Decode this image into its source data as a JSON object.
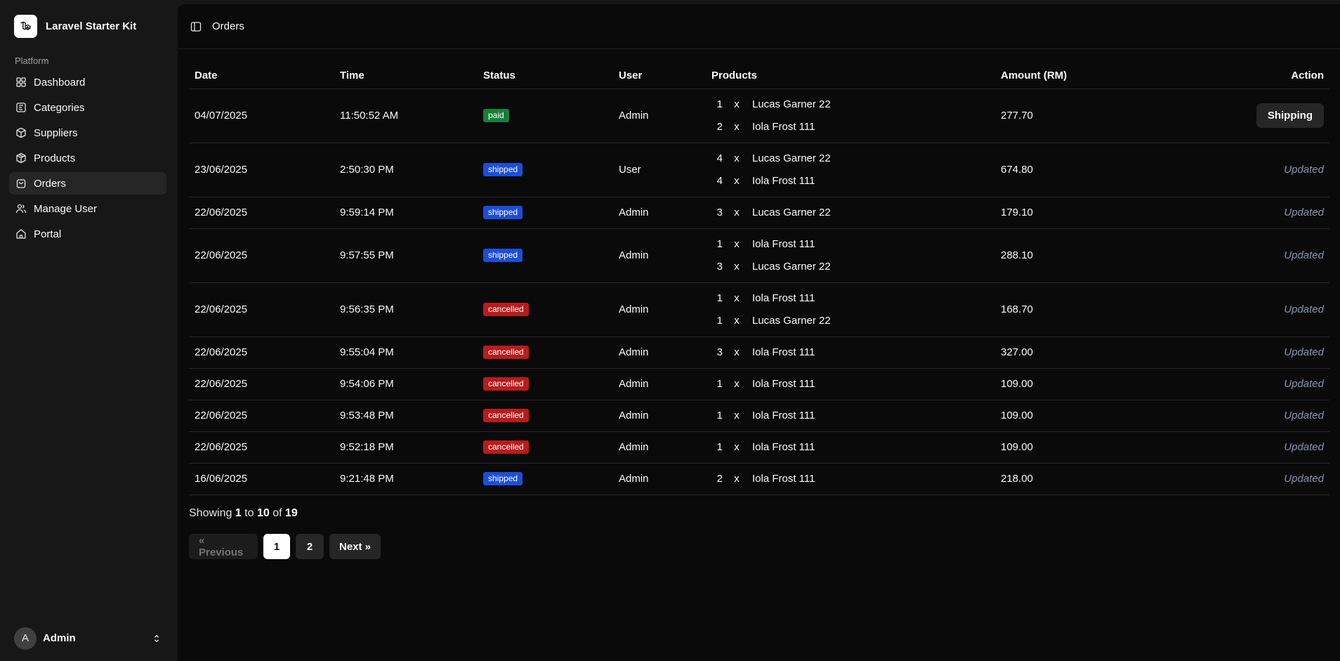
{
  "sidebar": {
    "brand": "Laravel Starter Kit",
    "group_label": "Platform",
    "items": [
      {
        "label": "Dashboard",
        "icon": "dashboard-icon",
        "active": false
      },
      {
        "label": "Categories",
        "icon": "categories-icon",
        "active": false
      },
      {
        "label": "Suppliers",
        "icon": "suppliers-icon",
        "active": false
      },
      {
        "label": "Products",
        "icon": "products-icon",
        "active": false
      },
      {
        "label": "Orders",
        "icon": "orders-icon",
        "active": true
      },
      {
        "label": "Manage User",
        "icon": "users-icon",
        "active": false
      },
      {
        "label": "Portal",
        "icon": "home-icon",
        "active": false
      }
    ],
    "user": {
      "initial": "A",
      "name": "Admin"
    }
  },
  "header": {
    "title": "Orders"
  },
  "table": {
    "columns": [
      "Date",
      "Time",
      "Status",
      "User",
      "Products",
      "Amount (RM)",
      "Action"
    ],
    "rows": [
      {
        "date": "04/07/2025",
        "time": "11:50:52 AM",
        "status": "paid",
        "user": "Admin",
        "products": [
          {
            "qty": "1",
            "x": "x",
            "name": "Lucas Garner 22"
          },
          {
            "qty": "2",
            "x": "x",
            "name": "Iola Frost 111"
          }
        ],
        "amount": "277.70",
        "action": "Shipping"
      },
      {
        "date": "23/06/2025",
        "time": "2:50:30 PM",
        "status": "shipped",
        "user": "User",
        "products": [
          {
            "qty": "4",
            "x": "x",
            "name": "Lucas Garner 22"
          },
          {
            "qty": "4",
            "x": "x",
            "name": "Iola Frost 111"
          }
        ],
        "amount": "674.80",
        "action": "Updated"
      },
      {
        "date": "22/06/2025",
        "time": "9:59:14 PM",
        "status": "shipped",
        "user": "Admin",
        "products": [
          {
            "qty": "3",
            "x": "x",
            "name": "Lucas Garner 22"
          }
        ],
        "amount": "179.10",
        "action": "Updated"
      },
      {
        "date": "22/06/2025",
        "time": "9:57:55 PM",
        "status": "shipped",
        "user": "Admin",
        "products": [
          {
            "qty": "1",
            "x": "x",
            "name": "Iola Frost 111"
          },
          {
            "qty": "3",
            "x": "x",
            "name": "Lucas Garner 22"
          }
        ],
        "amount": "288.10",
        "action": "Updated"
      },
      {
        "date": "22/06/2025",
        "time": "9:56:35 PM",
        "status": "cancelled",
        "user": "Admin",
        "products": [
          {
            "qty": "1",
            "x": "x",
            "name": "Iola Frost 111"
          },
          {
            "qty": "1",
            "x": "x",
            "name": "Lucas Garner 22"
          }
        ],
        "amount": "168.70",
        "action": "Updated"
      },
      {
        "date": "22/06/2025",
        "time": "9:55:04 PM",
        "status": "cancelled",
        "user": "Admin",
        "products": [
          {
            "qty": "3",
            "x": "x",
            "name": "Iola Frost 111"
          }
        ],
        "amount": "327.00",
        "action": "Updated"
      },
      {
        "date": "22/06/2025",
        "time": "9:54:06 PM",
        "status": "cancelled",
        "user": "Admin",
        "products": [
          {
            "qty": "1",
            "x": "x",
            "name": "Iola Frost 111"
          }
        ],
        "amount": "109.00",
        "action": "Updated"
      },
      {
        "date": "22/06/2025",
        "time": "9:53:48 PM",
        "status": "cancelled",
        "user": "Admin",
        "products": [
          {
            "qty": "1",
            "x": "x",
            "name": "Iola Frost 111"
          }
        ],
        "amount": "109.00",
        "action": "Updated"
      },
      {
        "date": "22/06/2025",
        "time": "9:52:18 PM",
        "status": "cancelled",
        "user": "Admin",
        "products": [
          {
            "qty": "1",
            "x": "x",
            "name": "Iola Frost 111"
          }
        ],
        "amount": "109.00",
        "action": "Updated"
      },
      {
        "date": "16/06/2025",
        "time": "9:21:48 PM",
        "status": "shipped",
        "user": "Admin",
        "products": [
          {
            "qty": "2",
            "x": "x",
            "name": "Iola Frost 111"
          }
        ],
        "amount": "218.00",
        "action": "Updated"
      }
    ]
  },
  "pagination": {
    "showing_prefix": "Showing",
    "from": "1",
    "to_word": "to",
    "to": "10",
    "of_word": "of",
    "total": "19",
    "prev_label": "« Previous",
    "pages": [
      "1",
      "2"
    ],
    "current_page": "1",
    "next_label": "Next »"
  },
  "colors": {
    "paid": "#15803d",
    "shipped": "#1d4ed8",
    "cancelled": "#b91c1c",
    "updated_text": "#8896ab"
  }
}
